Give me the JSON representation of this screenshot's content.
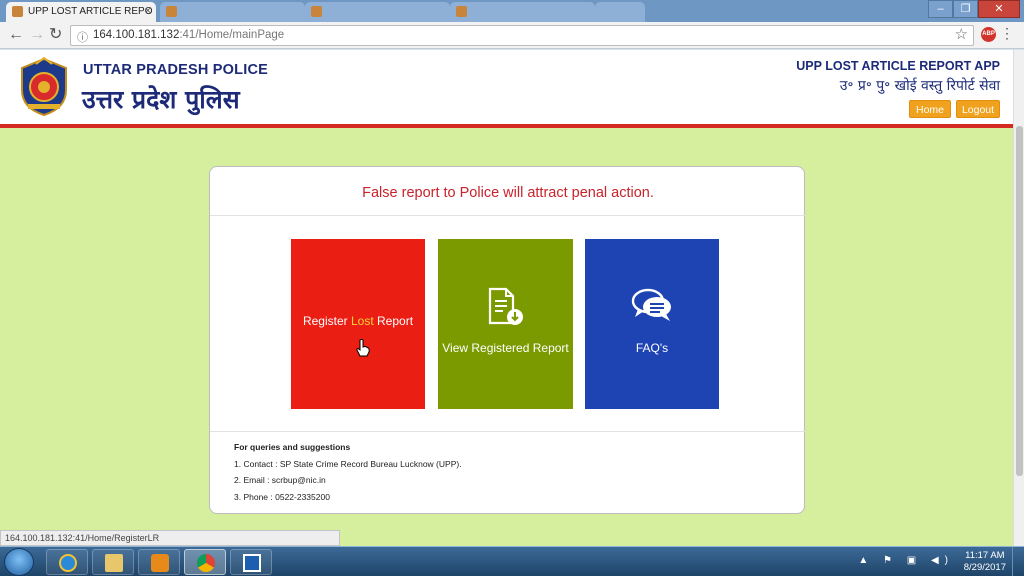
{
  "browser": {
    "active_tab": "UPP LOST ARTICLE REPO",
    "url_host": "164.100.181.132",
    "url_rest": ":41/Home/mainPage",
    "status_url": "164.100.181.132:41/Home/RegisterLR",
    "extension_badge": "ABP"
  },
  "header": {
    "brand_en": "UTTAR PRADESH POLICE",
    "brand_hi": "उत्तर प्रदेश पुलिस",
    "app_en": "UPP LOST ARTICLE REPORT APP",
    "app_hi": "उ॰ प्र॰ पु॰ खोई वस्तु रिपोर्ट सेवा",
    "home_label": "Home",
    "logout_label": "Logout"
  },
  "main": {
    "warning": "False report to Police will attract penal action.",
    "tiles": [
      {
        "label_pre": "Register ",
        "label_hl": "Lost",
        "label_post": " Report",
        "icon": "cursor-hand-icon",
        "color": "#ea1e13"
      },
      {
        "label": "View Registered Report",
        "icon": "document-download-icon",
        "color": "#7b9a00"
      },
      {
        "label": "FAQ's",
        "icon": "chat-bubbles-icon",
        "color": "#1e43b2"
      }
    ],
    "queries": {
      "title": "For queries and suggestions",
      "items": [
        "1. Contact : SP State Crime Record Bureau Lucknow (UPP).",
        "2. Email : scrbup@nic.in",
        "3. Phone : 0522-2335200"
      ]
    }
  },
  "taskbar": {
    "time": "11:17 AM",
    "date": "8/29/2017"
  }
}
